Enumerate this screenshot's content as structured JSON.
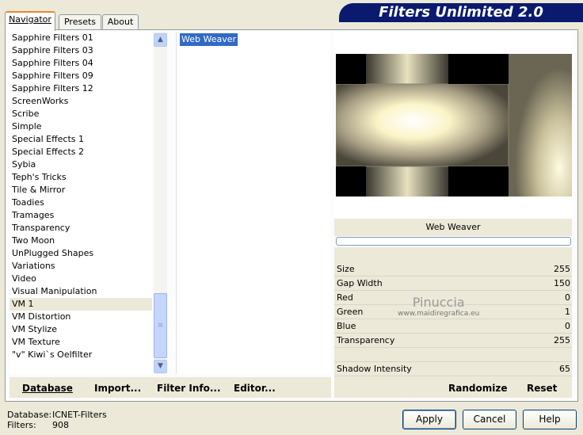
{
  "window": {
    "banner_title": "Filters Unlimited 2.0",
    "top_strip_text": "…"
  },
  "tabs": [
    {
      "label": "Navigator"
    },
    {
      "label": "Presets"
    },
    {
      "label": "About"
    }
  ],
  "categories": [
    "Sapphire Filters 01",
    "Sapphire Filters 03",
    "Sapphire Filters 04",
    "Sapphire Filters 09",
    "Sapphire Filters 12",
    "ScreenWorks",
    "Scribe",
    "Simple",
    "Special Effects 1",
    "Special Effects 2",
    "Sybia",
    "Teph's Tricks",
    "Tile & Mirror",
    "Toadies",
    "Tramages",
    "Transparency",
    "Two Moon",
    "UnPlugged Shapes",
    "Variations",
    "Video",
    "Visual Manipulation",
    "VM 1",
    "VM Distortion",
    "VM Stylize",
    "VM Texture",
    "\"v\" Kiwi`s Oelfilter"
  ],
  "selected_category": "VM 1",
  "filters": [
    "Web Weaver"
  ],
  "selected_filter": "Web Weaver",
  "preview": {
    "filter_name": "Web Weaver"
  },
  "params": [
    {
      "label": "Size",
      "value": "255"
    },
    {
      "label": "Gap Width",
      "value": "150"
    },
    {
      "label": "Red",
      "value": "0"
    },
    {
      "label": "Green",
      "value": "1"
    },
    {
      "label": "Blue",
      "value": "0"
    },
    {
      "label": "Transparency",
      "value": "255"
    },
    {
      "label": "",
      "value": ""
    },
    {
      "label": "Shadow Intensity",
      "value": "65"
    }
  ],
  "watermark": {
    "line1": "Pinuccia",
    "line2": "www.maidiregrafica.eu"
  },
  "left_buttons": {
    "database": "Database",
    "import": "Import...",
    "filter_info": "Filter Info...",
    "editor": "Editor..."
  },
  "right_buttons": {
    "randomize": "Randomize",
    "reset": "Reset"
  },
  "status": {
    "database_label": "Database:",
    "database_value": "ICNET-Filters",
    "filters_label": "Filters:",
    "filters_value": "908"
  },
  "dialog_buttons": {
    "apply": "Apply",
    "cancel": "Cancel",
    "help": "Help"
  },
  "colors": {
    "banner": "#0a1a6e",
    "selection": "#316ac5",
    "dialog_bg": "#ece9d8"
  }
}
